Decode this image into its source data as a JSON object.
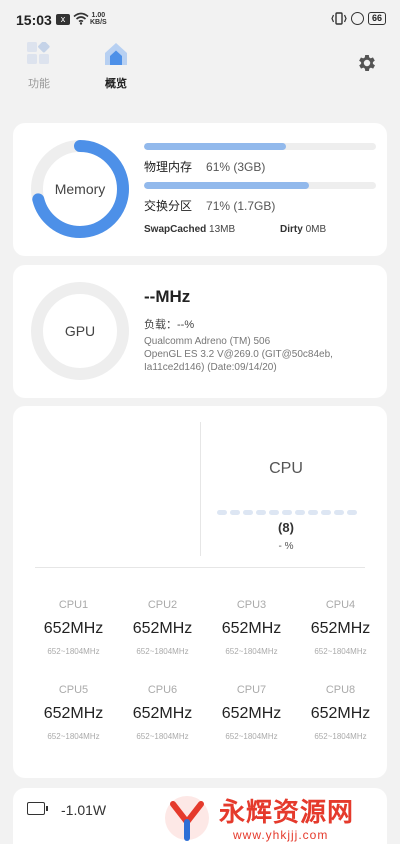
{
  "status_bar": {
    "time": "15:03",
    "notif_badge": "x",
    "net_speed_value": "1.00",
    "net_speed_unit": "KB/S",
    "battery": "66"
  },
  "tabs": [
    {
      "label": "功能",
      "icon": "grid-icon",
      "active": false
    },
    {
      "label": "概览",
      "icon": "home-icon",
      "active": true
    }
  ],
  "settings_icon": "gear-icon",
  "memory": {
    "ring_label": "Memory",
    "ring_fraction": 0.71,
    "physical_label": "物理内存",
    "physical_value": "61% (3GB)",
    "physical_fraction": 0.61,
    "swap_label": "交换分区",
    "swap_value": "71% (1.7GB)",
    "swap_fraction": 0.71,
    "swapcached_label": "SwapCached",
    "swapcached_value": "13MB",
    "dirty_label": "Dirty",
    "dirty_value": "0MB"
  },
  "gpu": {
    "ring_label": "GPU",
    "freq": "--MHz",
    "load": "负载：--%",
    "info": "Qualcomm Adreno (TM) 506\nOpenGL ES 3.2 V@269.0 (GIT@50c84eb, Ia11ce2d146) (Date:09/14/20)"
  },
  "cpu": {
    "title": "CPU",
    "core_count": "(8)",
    "percent": "- %",
    "cores": [
      {
        "name": "CPU1",
        "freq": "652MHz",
        "range": "652~1804MHz"
      },
      {
        "name": "CPU2",
        "freq": "652MHz",
        "range": "652~1804MHz"
      },
      {
        "name": "CPU3",
        "freq": "652MHz",
        "range": "652~1804MHz"
      },
      {
        "name": "CPU4",
        "freq": "652MHz",
        "range": "652~1804MHz"
      },
      {
        "name": "CPU5",
        "freq": "652MHz",
        "range": "652~1804MHz"
      },
      {
        "name": "CPU6",
        "freq": "652MHz",
        "range": "652~1804MHz"
      },
      {
        "name": "CPU7",
        "freq": "652MHz",
        "range": "652~1804MHz"
      },
      {
        "name": "CPU8",
        "freq": "652MHz",
        "range": "652~1804MHz"
      }
    ]
  },
  "battery_card": {
    "icon": "battery-icon",
    "watts": "-1.01W"
  },
  "watermark": {
    "text": "永辉资源网",
    "url": "www.yhkjjj.com"
  },
  "colors": {
    "accent": "#4d90e8",
    "accent_light": "#92b9ec",
    "track": "#eeeeee",
    "watermark": "#e53a2c"
  }
}
